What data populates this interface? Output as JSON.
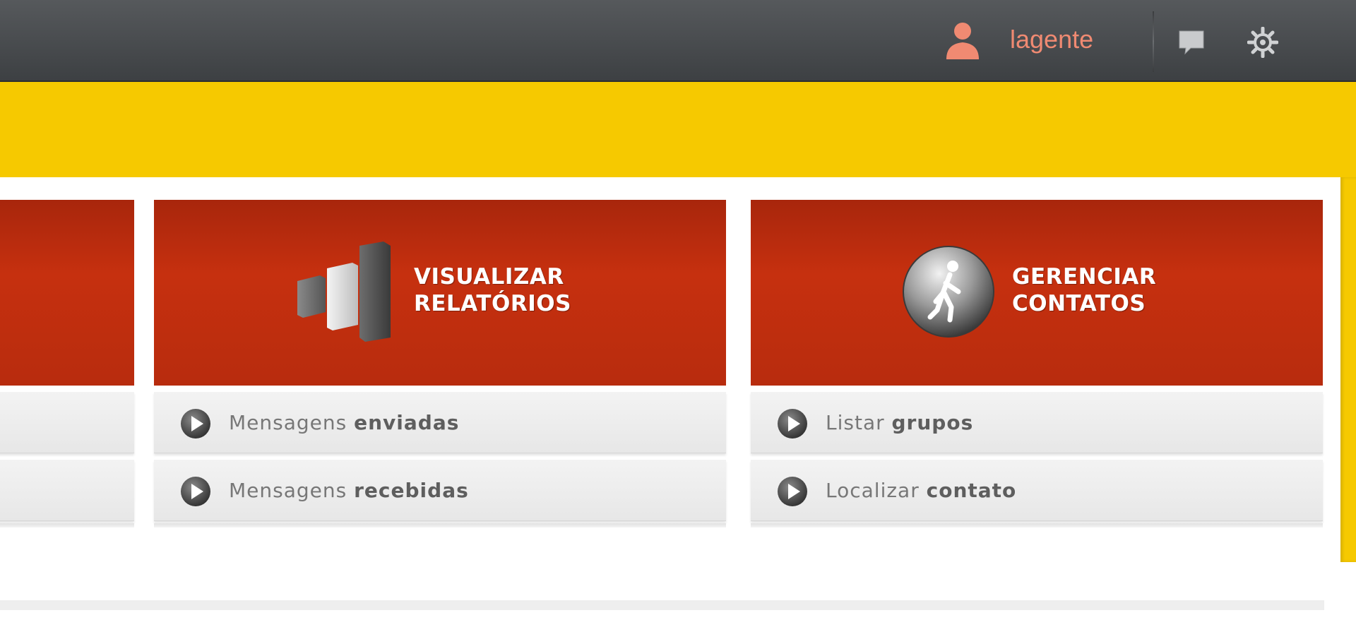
{
  "header": {
    "username": "lagente"
  },
  "cards": [
    {
      "id": "partial",
      "title_lines": [
        "",
        ""
      ],
      "items": [
        {
          "normal": "",
          "bold": ""
        },
        {
          "normal": "",
          "bold": ""
        }
      ]
    },
    {
      "id": "reports",
      "title_lines": [
        "VISUALIZAR",
        "RELATÓRIOS"
      ],
      "items": [
        {
          "normal": "Mensagens ",
          "bold": "enviadas"
        },
        {
          "normal": "Mensagens ",
          "bold": "recebidas"
        }
      ]
    },
    {
      "id": "contacts",
      "title_lines": [
        "GERENCIAR",
        "CONTATOS"
      ],
      "items": [
        {
          "normal": "Listar ",
          "bold": "grupos"
        },
        {
          "normal": "Localizar ",
          "bold": "contato"
        }
      ]
    }
  ],
  "colors": {
    "header_bg": "#45484b",
    "accent_yellow": "#f6c900",
    "card_red": "#c6300f",
    "username": "#f08a72"
  },
  "icons": {
    "user": "user-icon",
    "chat": "chat-bubble-icon",
    "settings": "gear-icon",
    "reports": "bar-chart-icon",
    "contacts": "walking-person-icon",
    "item": "play-circle-icon"
  }
}
